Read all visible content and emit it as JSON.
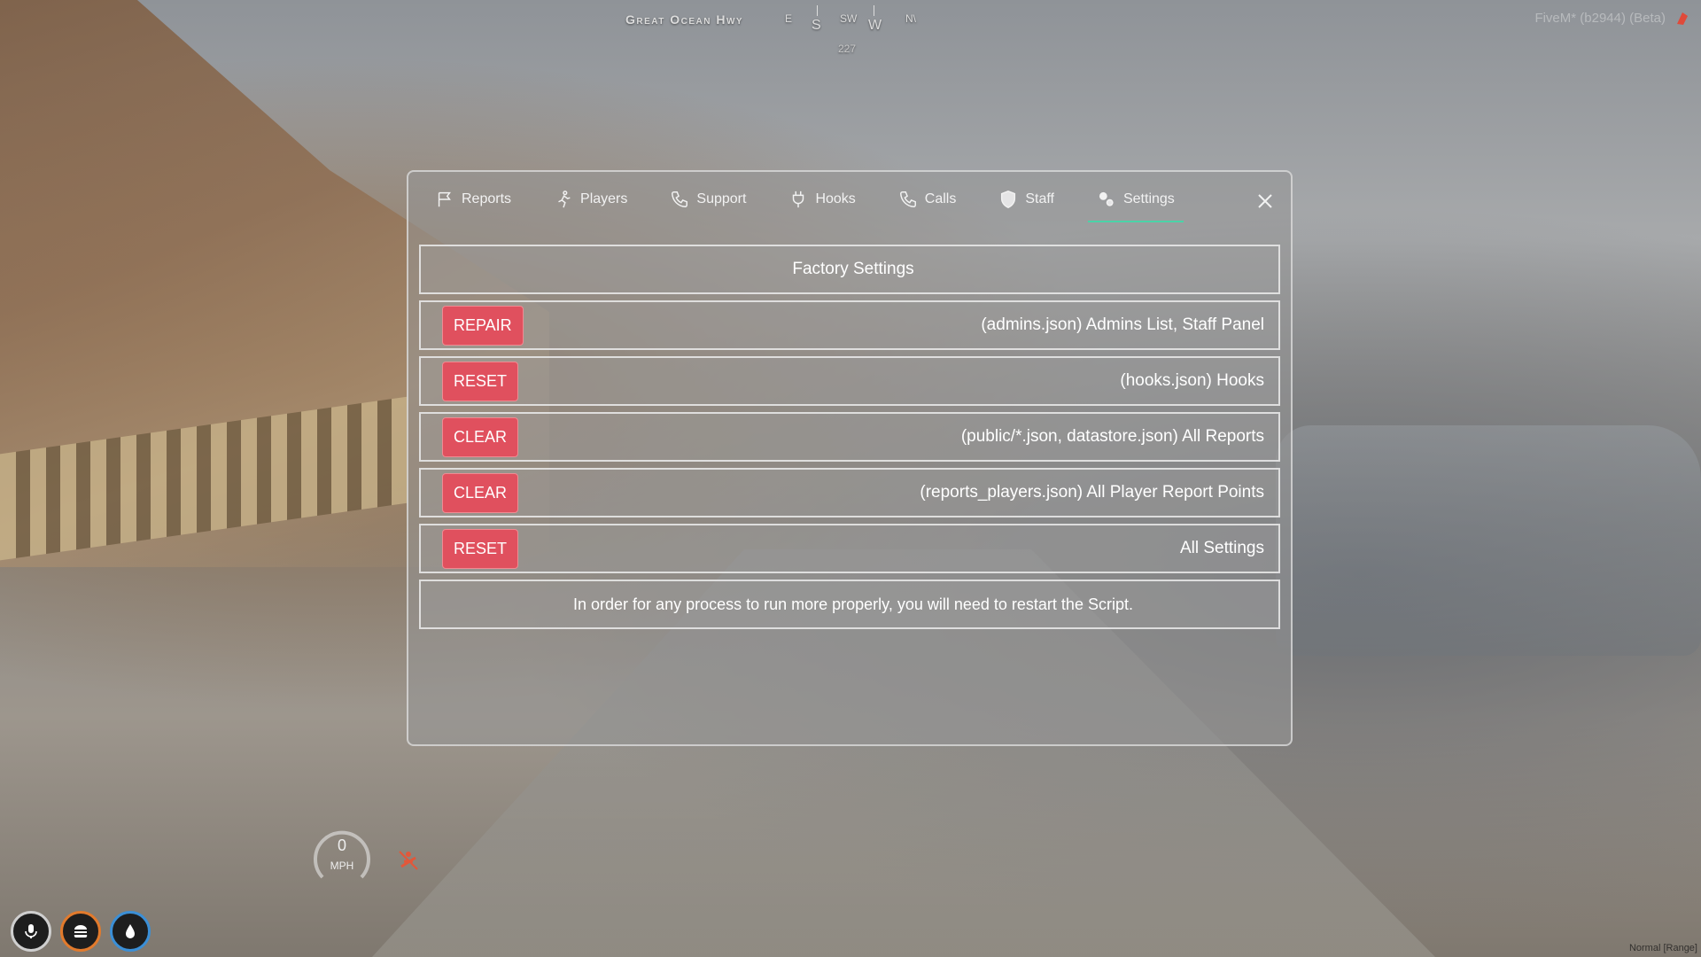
{
  "hud": {
    "street": "Great Ocean Hwy",
    "compass": {
      "e": "E",
      "s": "S",
      "sw": "SW",
      "w": "W",
      "nw": "N\\"
    },
    "heading": "227",
    "version": "FiveM* (b2944) (Beta)",
    "speed": {
      "value": "0",
      "unit": "MPH"
    },
    "voice_mode": "Normal [Range]"
  },
  "tabs": [
    {
      "label": "Reports",
      "icon": "flag-icon"
    },
    {
      "label": "Players",
      "icon": "running-person-icon"
    },
    {
      "label": "Support",
      "icon": "phone-icon"
    },
    {
      "label": "Hooks",
      "icon": "plug-icon"
    },
    {
      "label": "Calls",
      "icon": "phone-icon"
    },
    {
      "label": "Staff",
      "icon": "shield-icon"
    },
    {
      "label": "Settings",
      "icon": "gears-icon",
      "active": true
    }
  ],
  "panel": {
    "header": "Factory Settings",
    "rows": [
      {
        "button": "REPAIR",
        "label": "(admins.json) Admins List, Staff Panel"
      },
      {
        "button": "RESET",
        "label": "(hooks.json) Hooks"
      },
      {
        "button": "CLEAR",
        "label": "(public/*.json, datastore.json) All Reports"
      },
      {
        "button": "CLEAR",
        "label": "(reports_players.json) All Player Report Points"
      },
      {
        "button": "RESET",
        "label": "All Settings"
      }
    ],
    "note": "In order for any process to run more properly, you will need to restart the Script."
  },
  "colors": {
    "accent": "#4bd3a8",
    "danger": "#e0505e"
  }
}
